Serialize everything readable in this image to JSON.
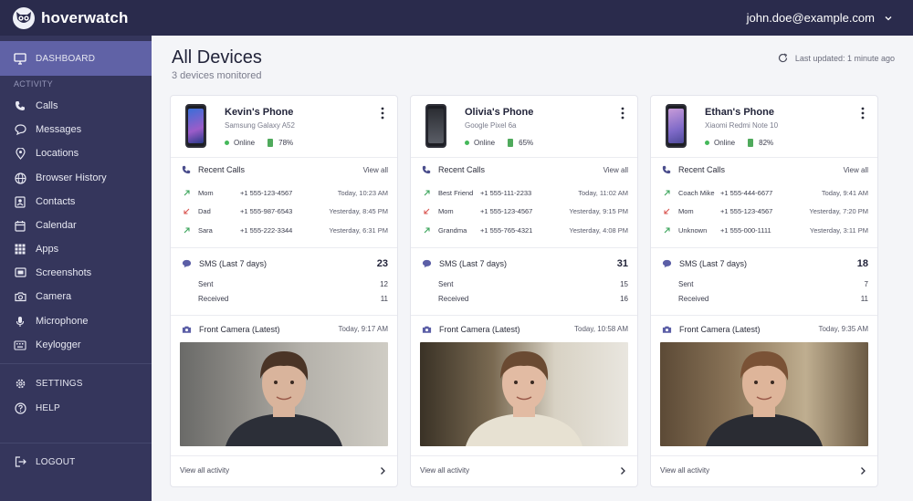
{
  "app": {
    "name": "hoverwatch",
    "account_email": "john.doe@example.com"
  },
  "sidebar": {
    "dashboard": "DASHBOARD",
    "section_label": "ACTIVITY",
    "items": [
      "Calls",
      "Messages",
      "Locations",
      "Browser History",
      "Contacts",
      "Calendar",
      "Apps",
      "Screenshots",
      "Camera",
      "Microphone",
      "Keylogger"
    ],
    "settings": "SETTINGS",
    "help": "HELP",
    "logout": "LOGOUT"
  },
  "page": {
    "title": "All Devices",
    "subtitle": "3 devices monitored",
    "last_updated": "Last updated: 1 minute ago"
  },
  "labels": {
    "recent_calls": "Recent Calls",
    "view_all": "View all",
    "sms_title": "SMS (Last 7 days)",
    "sent": "Sent",
    "received": "Received",
    "camera_title": "Front Camera (Latest)",
    "view_all_activity": "View all activity"
  },
  "colors": {
    "topbar": "#2a2b4c",
    "sidebar": "#35365c",
    "active": "#6062a6",
    "online": "#45b85a",
    "call_arrow": "#3aa45a"
  },
  "devices": [
    {
      "name": "Kevin's Phone",
      "model": "Samsung Galaxy A52",
      "status": "Online",
      "battery": "78%",
      "calls": [
        {
          "contact": "Mom",
          "number": "+1 555-123-4567",
          "time": "Today, 10:23 AM"
        },
        {
          "contact": "Dad",
          "number": "+1 555-987-6543",
          "time": "Yesterday, 8:45 PM"
        },
        {
          "contact": "Sara",
          "number": "+1 555-222-3344",
          "time": "Yesterday, 6:31 PM"
        }
      ],
      "sms_total": "23",
      "sms_sent": "12",
      "sms_received": "11",
      "camera_time": "Today, 9:17 AM"
    },
    {
      "name": "Olivia's Phone",
      "model": "Google Pixel 6a",
      "status": "Online",
      "battery": "65%",
      "calls": [
        {
          "contact": "Best Friend",
          "number": "+1 555-111-2233",
          "time": "Today, 11:02 AM"
        },
        {
          "contact": "Mom",
          "number": "+1 555-123-4567",
          "time": "Yesterday, 9:15 PM"
        },
        {
          "contact": "Grandma",
          "number": "+1 555-765-4321",
          "time": "Yesterday, 4:08 PM"
        }
      ],
      "sms_total": "31",
      "sms_sent": "15",
      "sms_received": "16",
      "camera_time": "Today, 10:58 AM"
    },
    {
      "name": "Ethan's Phone",
      "model": "Xiaomi Redmi Note 10",
      "status": "Online",
      "battery": "82%",
      "calls": [
        {
          "contact": "Coach Mike",
          "number": "+1 555-444-6677",
          "time": "Today, 9:41 AM"
        },
        {
          "contact": "Mom",
          "number": "+1 555-123-4567",
          "time": "Yesterday, 7:20 PM"
        },
        {
          "contact": "Unknown",
          "number": "+1 555-000-1111",
          "time": "Yesterday, 3:11 PM"
        }
      ],
      "sms_total": "18",
      "sms_sent": "7",
      "sms_received": "11",
      "camera_time": "Today, 9:35 AM"
    }
  ]
}
